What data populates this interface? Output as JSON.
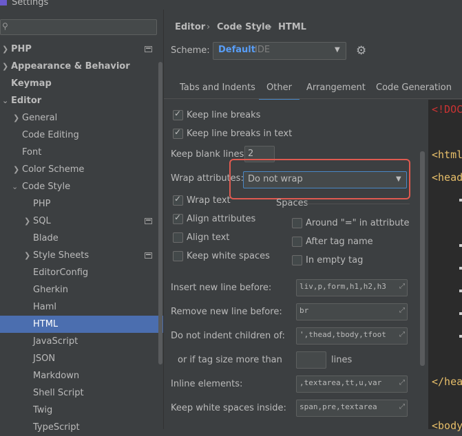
{
  "window": {
    "title": "Settings"
  },
  "sidebar": {
    "search": {
      "value": ""
    },
    "items": [
      {
        "label": "PHP"
      },
      {
        "label": "Appearance & Behavior"
      },
      {
        "label": "Keymap"
      },
      {
        "label": "Editor"
      },
      {
        "label": "General"
      },
      {
        "label": "Code Editing"
      },
      {
        "label": "Font"
      },
      {
        "label": "Color Scheme"
      },
      {
        "label": "Code Style"
      },
      {
        "label": "PHP"
      },
      {
        "label": "SQL"
      },
      {
        "label": "Blade"
      },
      {
        "label": "Style Sheets"
      },
      {
        "label": "EditorConfig"
      },
      {
        "label": "Gherkin"
      },
      {
        "label": "Haml"
      },
      {
        "label": "HTML"
      },
      {
        "label": "JavaScript"
      },
      {
        "label": "JSON"
      },
      {
        "label": "Markdown"
      },
      {
        "label": "Shell Script"
      },
      {
        "label": "Twig"
      },
      {
        "label": "TypeScript"
      }
    ]
  },
  "breadcrumb": [
    "Editor",
    "Code Style",
    "HTML"
  ],
  "scheme": {
    "label": "Scheme:",
    "value": "Default",
    "scope": "IDE"
  },
  "tabs": [
    {
      "label": "Tabs and Indents"
    },
    {
      "label": "Other"
    },
    {
      "label": "Arrangement"
    },
    {
      "label": "Code Generation"
    }
  ],
  "other": {
    "keep_line_breaks": {
      "label": "Keep line breaks",
      "checked": true
    },
    "keep_line_breaks_text": {
      "label": "Keep line breaks in text",
      "checked": true
    },
    "keep_blank_lines": {
      "label": "Keep blank lines:",
      "value": "2"
    },
    "wrap_attributes": {
      "label": "Wrap attributes:",
      "value": "Do not wrap"
    },
    "wrap_text": {
      "label": "Wrap text",
      "checked": true
    },
    "align_attributes": {
      "label": "Align attributes",
      "checked": true
    },
    "align_text": {
      "label": "Align text",
      "checked": false
    },
    "keep_white_spaces": {
      "label": "Keep white spaces",
      "checked": false
    },
    "spaces": {
      "title": "Spaces",
      "around_eq": {
        "label": "Around \"=\" in attribute",
        "checked": false
      },
      "after_tag_name": {
        "label": "After tag name",
        "checked": false
      },
      "in_empty_tag": {
        "label": "In empty tag",
        "checked": false
      }
    },
    "insert_new_line_before": {
      "label": "Insert new line before:",
      "value": "liv,p,form,h1,h2,h3"
    },
    "remove_new_line_before": {
      "label": "Remove new line before:",
      "value": "br"
    },
    "do_not_indent": {
      "label": "Do not indent children of:",
      "value": "',thead,tbody,tfoot"
    },
    "tag_size": {
      "label": "or if tag size more than",
      "value": "",
      "unit": "lines"
    },
    "inline_elements": {
      "label": "Inline elements:",
      "value": ",textarea,tt,u,var"
    },
    "keep_white_spaces_inside": {
      "label": "Keep white spaces inside:",
      "value": "span,pre,textarea"
    }
  },
  "preview": {
    "lines": [
      "<!DOC",
      "<html",
      "<head",
      "</hea",
      "<body"
    ]
  }
}
